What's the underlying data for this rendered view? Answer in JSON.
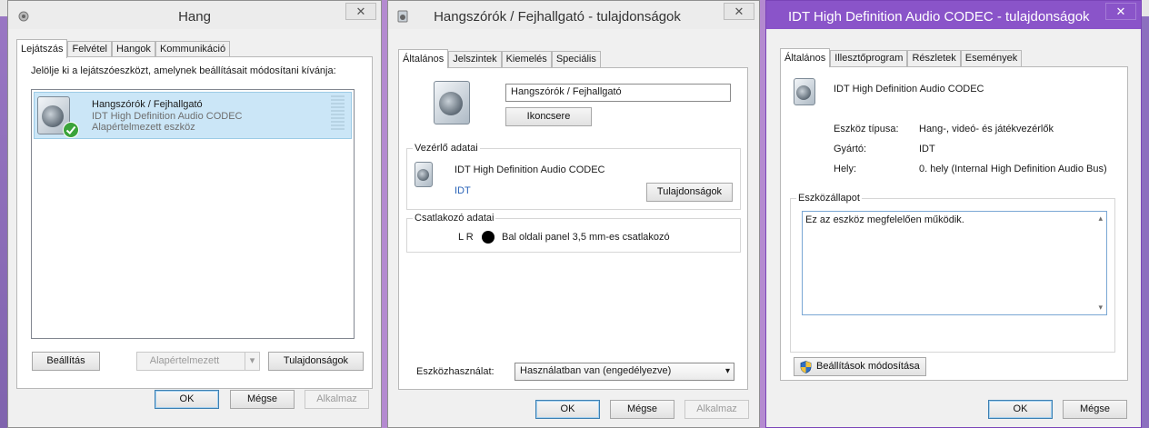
{
  "hang": {
    "title": "Hang",
    "close": "✕",
    "tabs": [
      "Lejátszás",
      "Felvétel",
      "Hangok",
      "Kommunikáció"
    ],
    "instruction": "Jelölje ki a lejátszóeszközt, amelynek beállításait módosítani kívánja:",
    "device": {
      "name": "Hangszórók / Fejhallgató",
      "driver": "IDT High Definition Audio CODEC",
      "status": "Alapértelmezett eszköz"
    },
    "buttons": {
      "configure": "Beállítás",
      "set_default": "Alapértelmezett",
      "properties": "Tulajdonságok"
    },
    "footer": {
      "ok": "OK",
      "cancel": "Mégse",
      "apply": "Alkalmaz"
    }
  },
  "spk": {
    "title": "Hangszórók / Fejhallgató - tulajdonságok",
    "close": "✕",
    "tabs": [
      "Általános",
      "Jelszintek",
      "Kiemelés",
      "Speciális"
    ],
    "name_value": "Hangszórók / Fejhallgató",
    "change_icon": "Ikoncsere",
    "controller": {
      "label": "Vezérlő adatai",
      "name": "IDT High Definition Audio CODEC",
      "vendor": "IDT",
      "properties": "Tulajdonságok"
    },
    "jack": {
      "label": "Csatlakozó adatai",
      "lr": "L R",
      "desc": "Bal oldali panel 3,5 mm-es csatlakozó"
    },
    "usage_label": "Eszközhasználat:",
    "usage_value": "Használatban van (engedélyezve)",
    "footer": {
      "ok": "OK",
      "cancel": "Mégse",
      "apply": "Alkalmaz"
    }
  },
  "codec": {
    "title": "IDT High Definition Audio CODEC - tulajdonságok",
    "close": "✕",
    "tabs": [
      "Általános",
      "Illesztőprogram",
      "Részletek",
      "Események"
    ],
    "device_name": "IDT High Definition Audio CODEC",
    "type_label": "Eszköz típusa:",
    "type_value": "Hang-, videó- és játékvezérlők",
    "manufacturer_label": "Gyártó:",
    "manufacturer_value": "IDT",
    "location_label": "Hely:",
    "location_value": "0. hely (Internal High Definition Audio Bus)",
    "status_label": "Eszközállapot",
    "status_text": "Ez az eszköz megfelelően működik.",
    "change_settings": "Beállítások módosítása",
    "footer": {
      "ok": "OK",
      "cancel": "Mégse"
    }
  },
  "colors": {
    "active_title": "#8a54c9",
    "desktop": "#b48ad0",
    "check": "#3aa33a"
  }
}
